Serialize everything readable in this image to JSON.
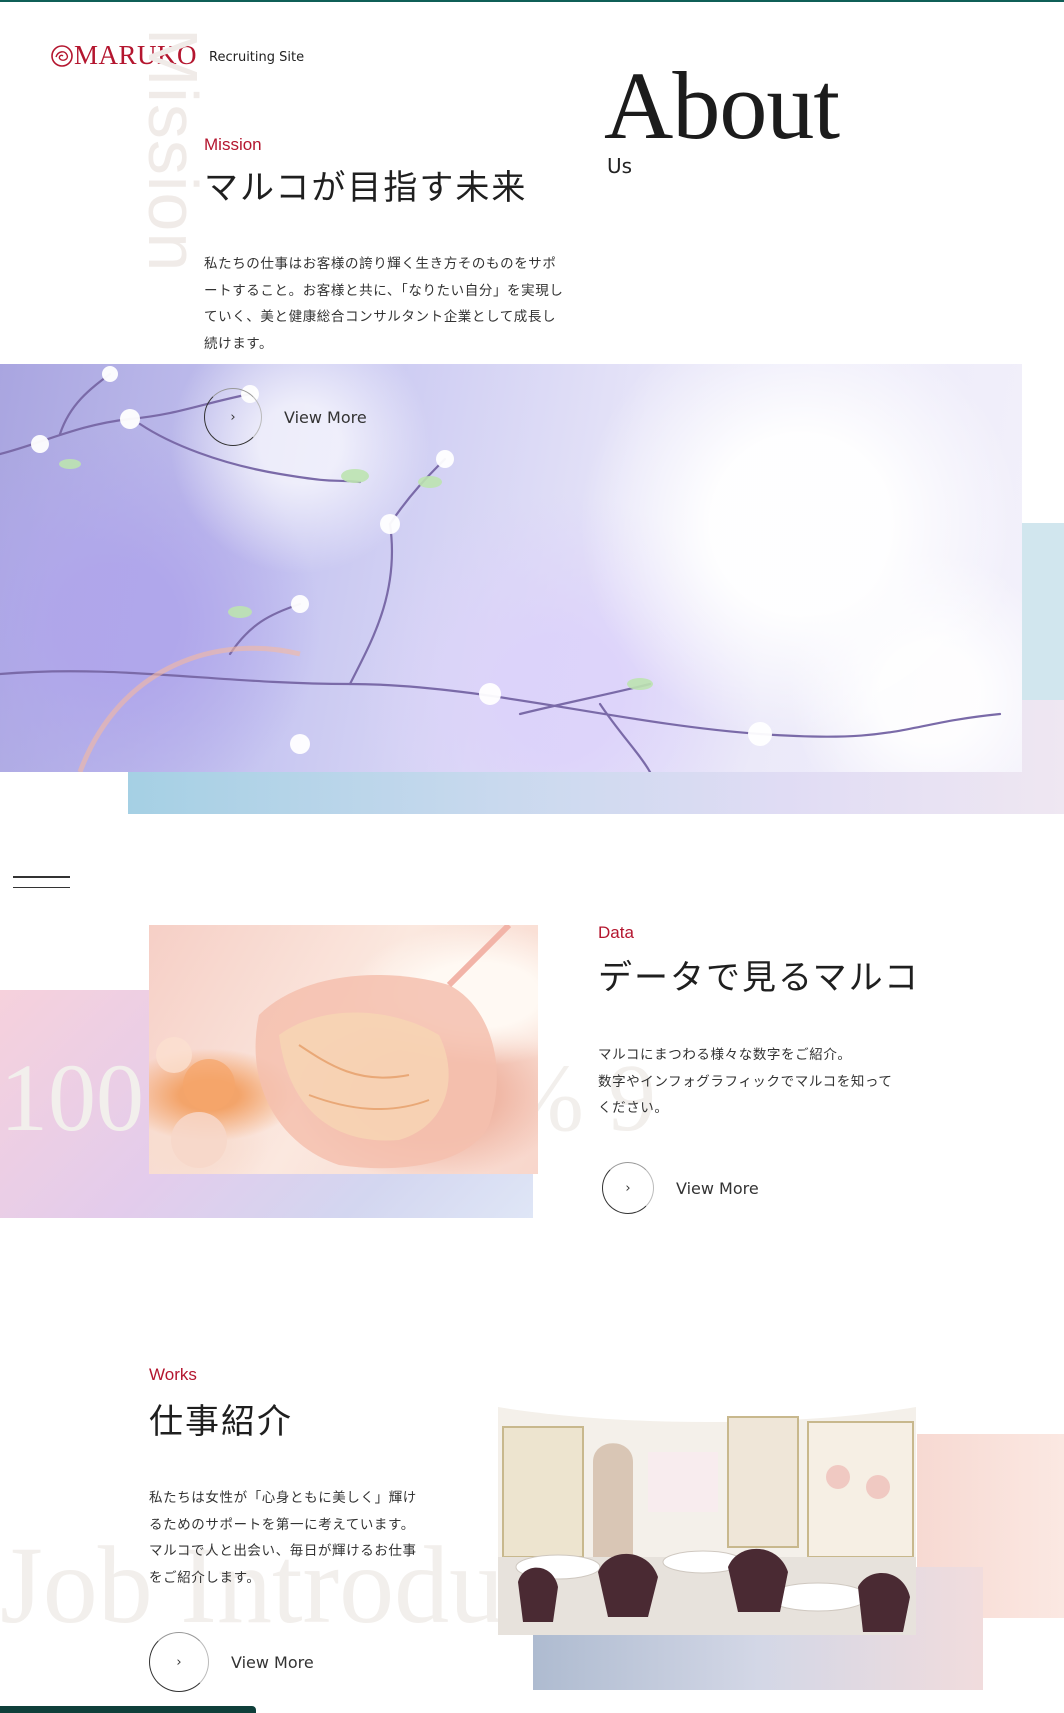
{
  "brand": {
    "name": "MARUKO",
    "subtitle": "Recruiting Site",
    "color": "#b4162f"
  },
  "about": {
    "title": "About",
    "subtitle": "Us"
  },
  "mission": {
    "watermark": "Mission",
    "label": "Mission",
    "title": "マルコが目指す未来",
    "body": [
      "私たちの仕事はお客様の誇り輝く生き方そのものをサポ",
      "ートすること。お客様と共に、「なりたい自分」を実現し",
      "ていく、美と健康総合コンサルタント企業として成長し",
      "続けます。"
    ],
    "cta": "View More",
    "cta_icon": "chevron-right-icon"
  },
  "data": {
    "label": "Data",
    "title": "データで見るマルコ",
    "body": [
      "マルコにまつわる様々な数字をご紹介。",
      "数字やインフォグラフィックでマルコを知って",
      "ください。"
    ],
    "watermark": "100 5 20 100% 9",
    "cta": "View More"
  },
  "works": {
    "label": "Works",
    "title": "仕事紹介",
    "body": [
      "私たちは女性が「心身ともに美しく」輝け",
      "るためのサポートを第一に考えています。",
      "マルコで人と出会い、毎日が輝けるお仕事",
      "をご紹介します。"
    ],
    "watermark": "Job Introduction",
    "cta": "View More"
  },
  "colors": {
    "accent": "#b4162f",
    "topline": "#0f5f57"
  }
}
